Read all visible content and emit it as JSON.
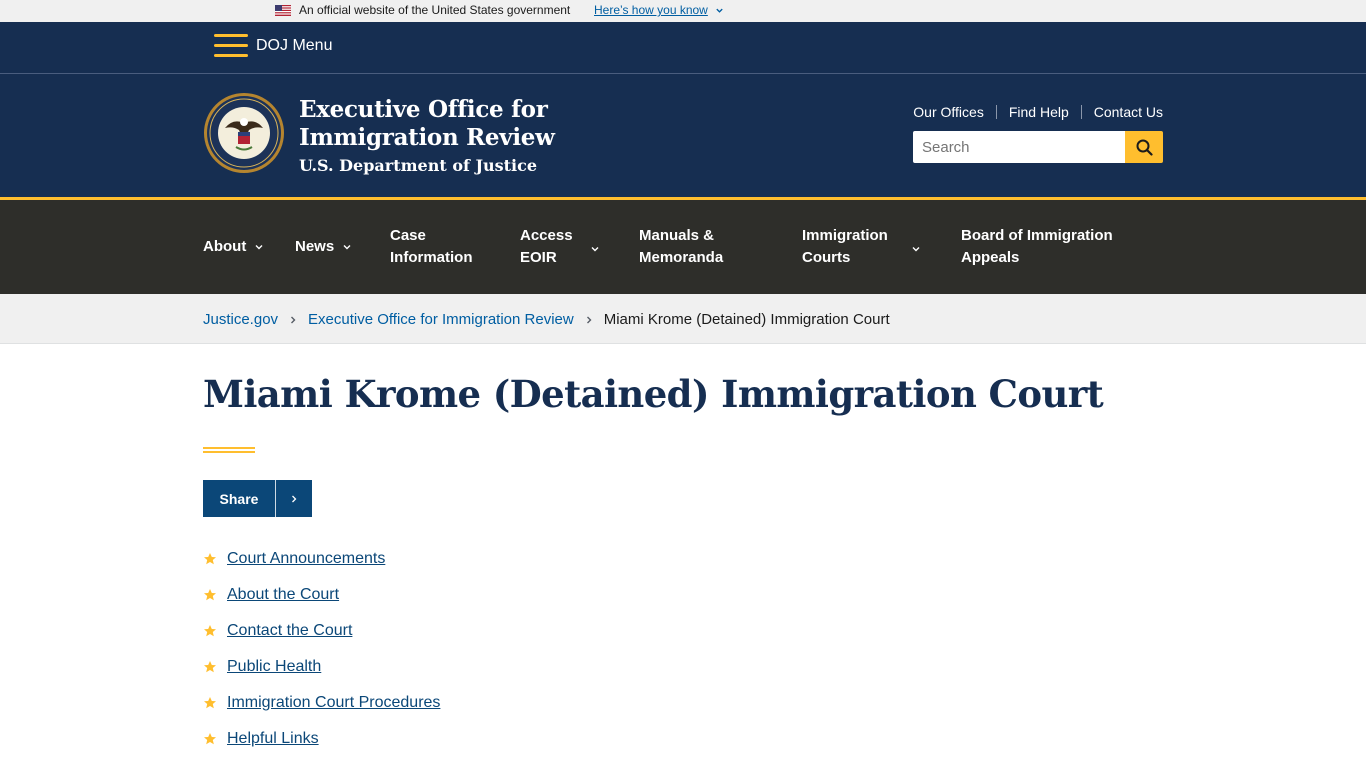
{
  "gov_banner": {
    "official_text": "An official website of the United States government",
    "how_link": "Here’s how you know"
  },
  "doj_bar": {
    "menu_label": "DOJ Menu"
  },
  "header": {
    "agency_line1": "Executive Office for",
    "agency_line2": "Immigration Review",
    "department": "U.S. Department of Justice",
    "utility_links": [
      "Our Offices",
      "Find Help",
      "Contact Us"
    ],
    "search_placeholder": "Search"
  },
  "primary_nav": {
    "items": [
      {
        "line1": "About",
        "line2": ""
      },
      {
        "line1": "News",
        "line2": ""
      },
      {
        "line1": "Case",
        "line2": "Information"
      },
      {
        "line1": "Access",
        "line2": "EOIR"
      },
      {
        "line1": "Manuals &",
        "line2": "Memoranda"
      },
      {
        "line1": "Immigration",
        "line2": "Courts"
      },
      {
        "line1": "Board of Immigration",
        "line2": "Appeals"
      }
    ]
  },
  "breadcrumb": {
    "items": [
      "Justice.gov",
      "Executive Office for Immigration Review"
    ],
    "current": "Miami Krome (Detained) Immigration Court"
  },
  "main": {
    "title": "Miami Krome (Detained) Immigration Court",
    "share_label": "Share",
    "links": [
      "Court Announcements",
      "About the Court",
      "Contact the Court",
      "Public Health",
      "Immigration Court Procedures",
      "Helpful Links"
    ]
  },
  "colors": {
    "navy": "#162e51",
    "gold": "#ffbe2e",
    "nav_dark": "#2e2e2a",
    "link_blue": "#005ea2"
  }
}
